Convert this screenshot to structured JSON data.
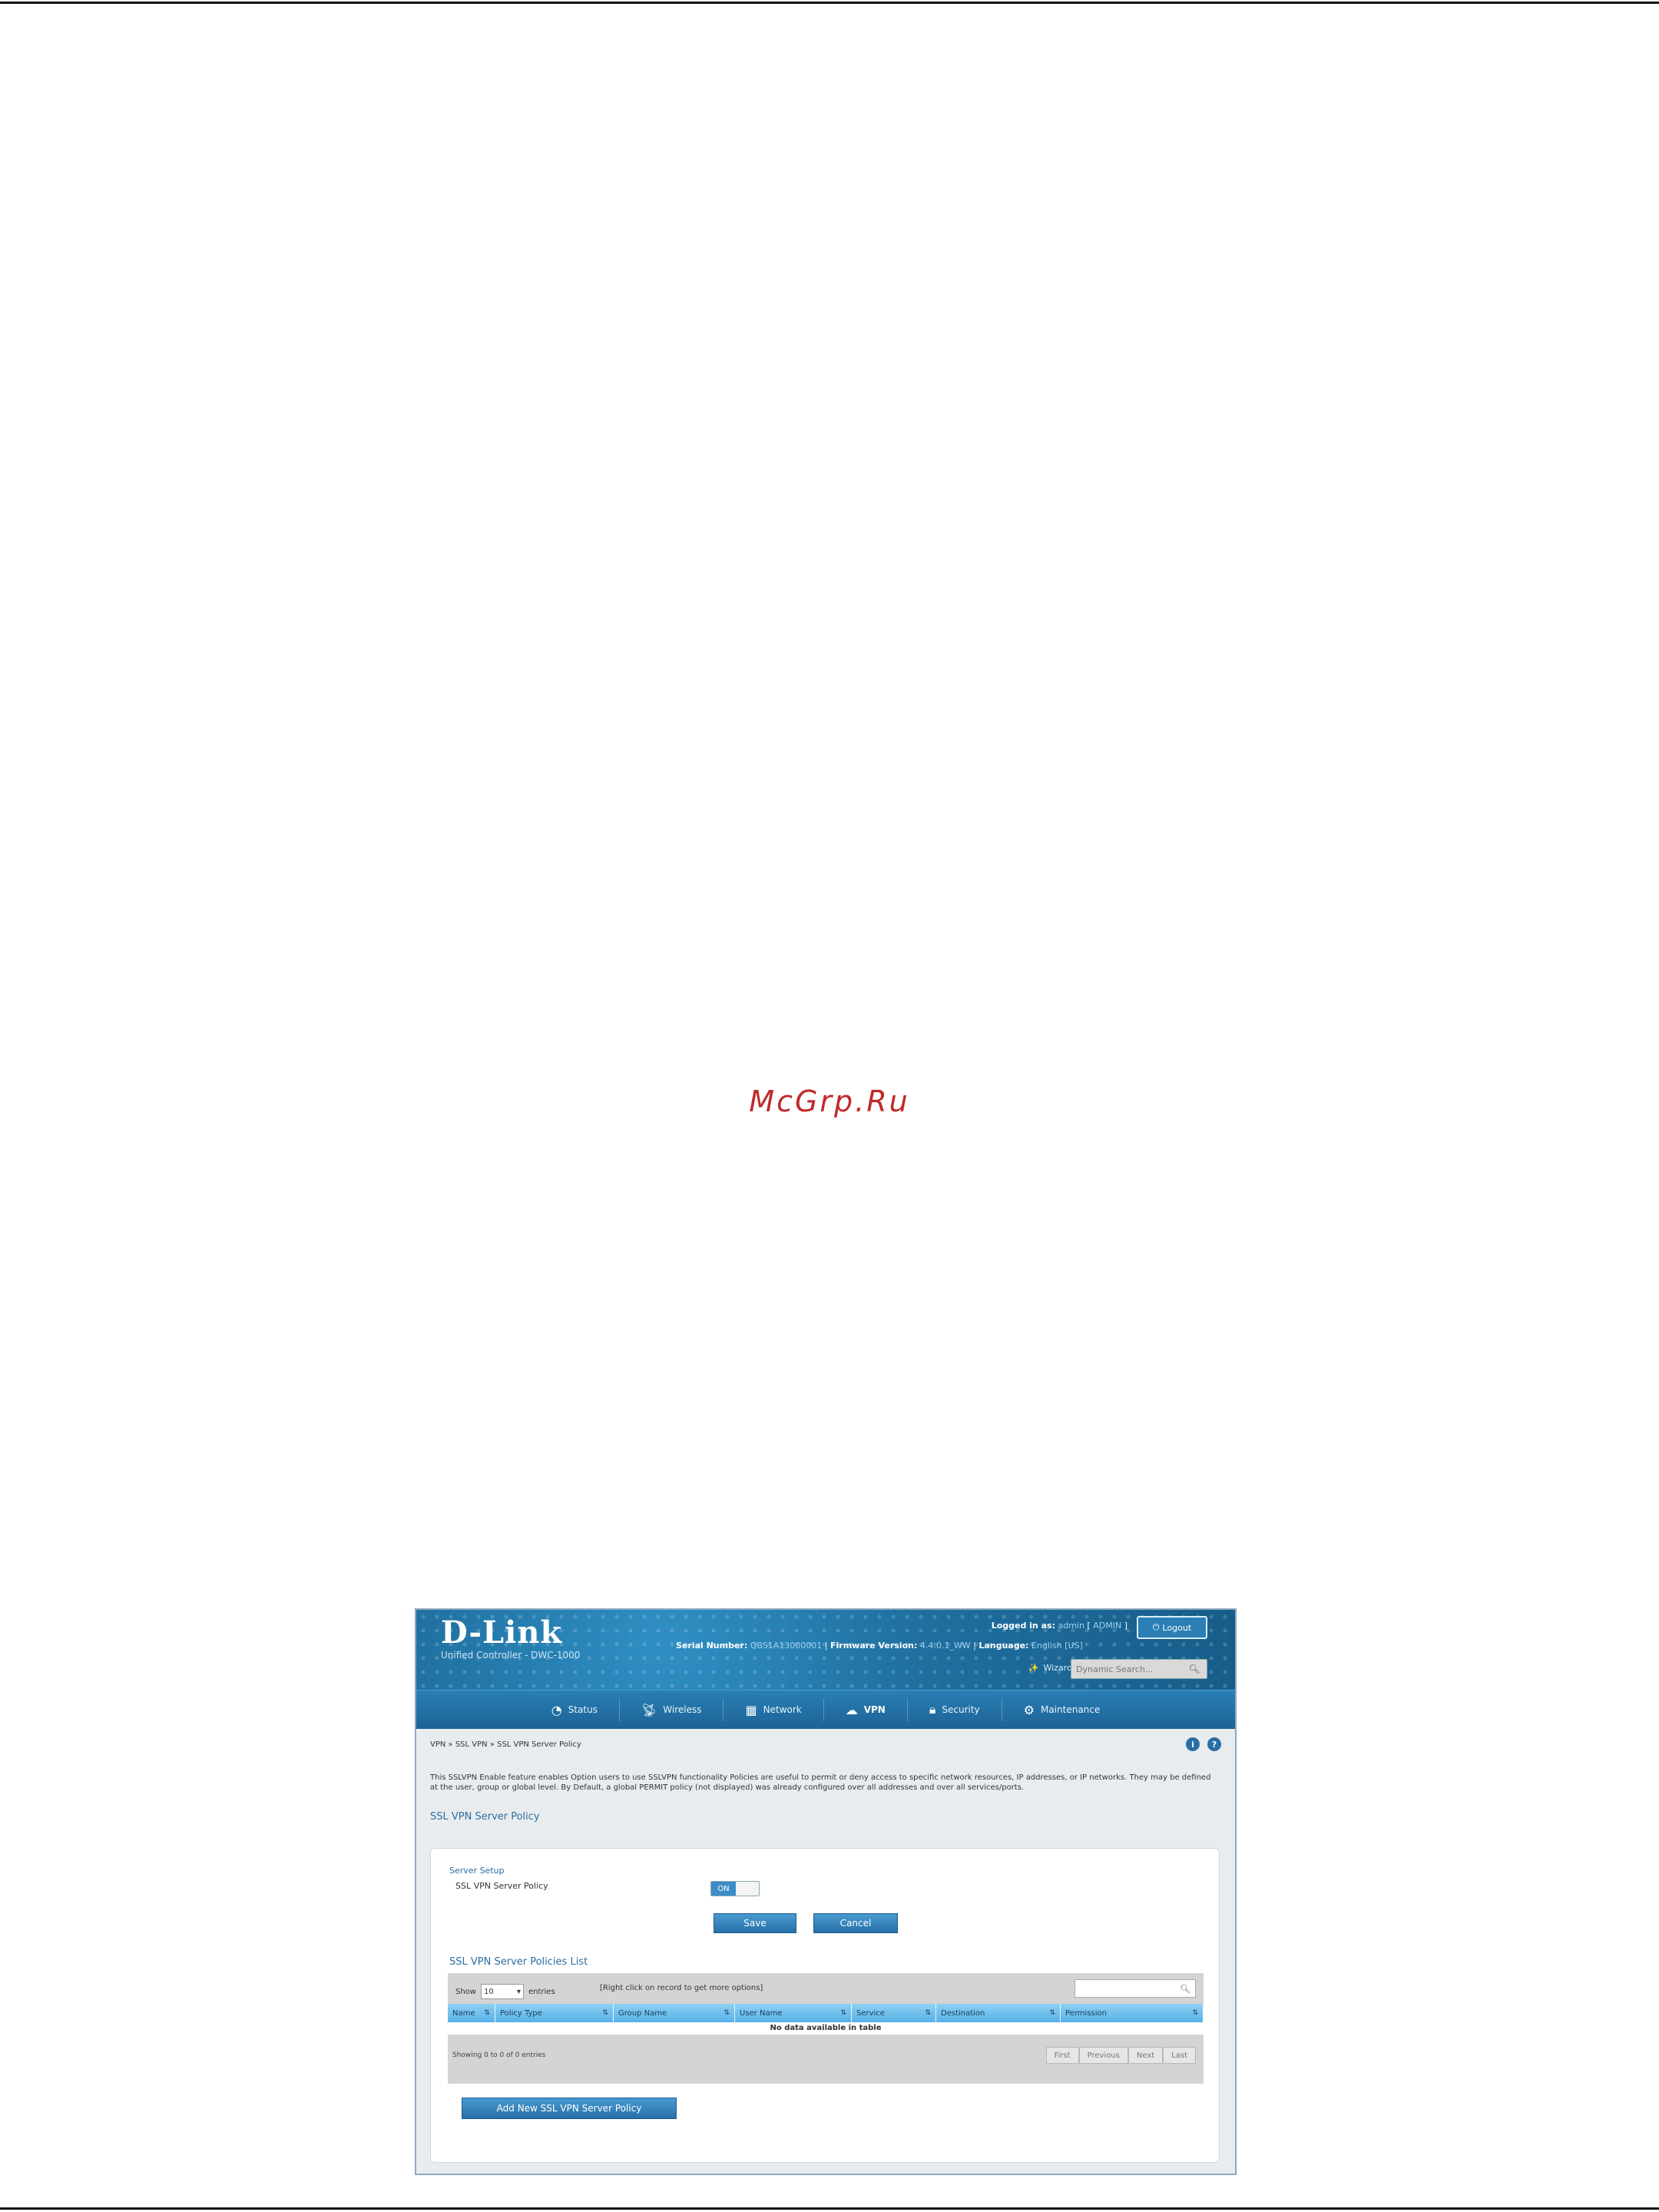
{
  "watermark": "McGrp.Ru",
  "app": {
    "logo": "D-Link",
    "subtitle": "Unified Controller - DWC-1000",
    "serial_label": "Serial Number:",
    "serial_value": "QBS1A13000001",
    "firmware_label": "Firmware Version:",
    "firmware_value": "4.4.0.1_WW",
    "language_label": "Language:",
    "language_value": "English [US]",
    "logged_in_label": "Logged in as:",
    "user": "admin",
    "role": "ADMIN",
    "logout": "Logout",
    "wizard": "Wizard",
    "search_placeholder": "Dynamic Search..."
  },
  "nav": [
    {
      "label": "Status",
      "icon": "dashboard-icon"
    },
    {
      "label": "Wireless",
      "icon": "antenna-icon"
    },
    {
      "label": "Network",
      "icon": "network-icon"
    },
    {
      "label": "VPN",
      "icon": "cloud-icon",
      "active": true
    },
    {
      "label": "Security",
      "icon": "lock-icon"
    },
    {
      "label": "Maintenance",
      "icon": "gear-icon"
    }
  ],
  "breadcrumb": "VPN  »  SSL VPN  »  SSL VPN Server Policy",
  "description": "This SSLVPN Enable feature enables Option users to use SSLVPN functionality Policies are useful to permit or deny access to specific network resources, IP addresses, or IP networks. They may be defined at the user, group or global level. By Default, a global PERMIT policy (not displayed) was already configured over all addresses and over all services/ports.",
  "page_title": "SSL VPN Server Policy",
  "form": {
    "section": "Server Setup",
    "field_label": "SSL VPN Server Policy",
    "toggle_on": "ON",
    "save": "Save",
    "cancel": "Cancel"
  },
  "list": {
    "title": "SSL VPN Server Policies List",
    "show_label": "Show",
    "show_value": "10",
    "entries_label": "entries",
    "hint": "[Right click on record to get more options]",
    "columns": [
      "Name",
      "Policy Type",
      "Group Name",
      "User Name",
      "Service",
      "Destination",
      "Permission"
    ],
    "empty": "No data available in table",
    "showing": "Showing 0 to 0 of 0 entries",
    "pager": [
      "First",
      "Previous",
      "Next",
      "Last"
    ],
    "add_button": "Add New SSL VPN Server Policy"
  }
}
